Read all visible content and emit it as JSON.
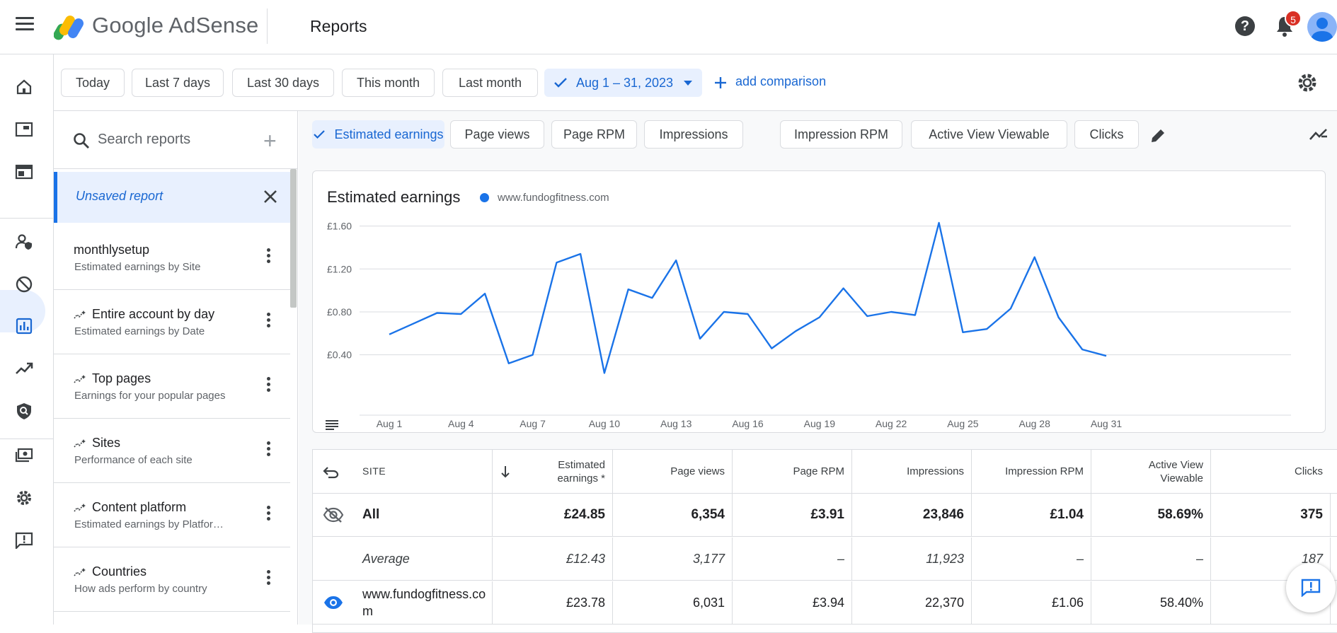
{
  "header": {
    "brand": "Google AdSense",
    "page_title": "Reports",
    "notifications_count": "5"
  },
  "date_filters": {
    "chips": [
      "Today",
      "Last 7 days",
      "Last 30 days",
      "This month",
      "Last month"
    ],
    "selected_range": "Aug 1 – 31, 2023",
    "add_comparison": "add comparison"
  },
  "reports": {
    "search_placeholder": "Search reports",
    "unsaved_label": "Unsaved report",
    "items": [
      {
        "title": "monthlysetup",
        "subtitle": "Estimated earnings by Site",
        "sparkle": false
      },
      {
        "title": "Entire account by day",
        "subtitle": "Estimated earnings by Date",
        "sparkle": true
      },
      {
        "title": "Top pages",
        "subtitle": "Earnings for your popular pages",
        "sparkle": true
      },
      {
        "title": "Sites",
        "subtitle": "Performance of each site",
        "sparkle": true
      },
      {
        "title": "Content platform",
        "subtitle": "Estimated earnings by Platfor…",
        "sparkle": true
      },
      {
        "title": "Countries",
        "subtitle": "How ads perform by country",
        "sparkle": true
      }
    ]
  },
  "metrics": {
    "chips": [
      "Estimated earnings",
      "Page views",
      "Page RPM",
      "Impressions",
      "Impression RPM",
      "Active View Viewable",
      "Clicks"
    ],
    "selected": "Estimated earnings"
  },
  "chart": {
    "title": "Estimated earnings",
    "legend": "www.fundogfitness.com",
    "accent": "#1a73e8"
  },
  "chart_data": {
    "type": "line",
    "title": "Estimated earnings",
    "series": [
      {
        "name": "www.fundogfitness.com",
        "values": [
          0.59,
          0.69,
          0.79,
          0.78,
          0.97,
          0.32,
          0.4,
          1.26,
          1.34,
          0.23,
          1.01,
          0.93,
          1.28,
          0.55,
          0.8,
          0.78,
          0.46,
          0.62,
          0.75,
          1.02,
          0.76,
          0.8,
          0.77,
          1.63,
          0.61,
          0.64,
          0.83,
          1.31,
          0.75,
          0.45,
          0.39
        ]
      }
    ],
    "x": [
      "Aug 1",
      "Aug 2",
      "Aug 3",
      "Aug 4",
      "Aug 5",
      "Aug 6",
      "Aug 7",
      "Aug 8",
      "Aug 9",
      "Aug 10",
      "Aug 11",
      "Aug 12",
      "Aug 13",
      "Aug 14",
      "Aug 15",
      "Aug 16",
      "Aug 17",
      "Aug 18",
      "Aug 19",
      "Aug 20",
      "Aug 21",
      "Aug 22",
      "Aug 23",
      "Aug 24",
      "Aug 25",
      "Aug 26",
      "Aug 27",
      "Aug 28",
      "Aug 29",
      "Aug 30",
      "Aug 31"
    ],
    "x_tick_labels": [
      "Aug 1",
      "Aug 4",
      "Aug 7",
      "Aug 10",
      "Aug 13",
      "Aug 16",
      "Aug 19",
      "Aug 22",
      "Aug 25",
      "Aug 28",
      "Aug 31"
    ],
    "y_tick_labels": [
      "£0.40",
      "£0.80",
      "£1.20",
      "£1.60"
    ],
    "y_ticks": [
      0.4,
      0.8,
      1.2,
      1.6
    ],
    "ylim": [
      0.2,
      1.65
    ],
    "grid": true
  },
  "table": {
    "headers": [
      "SITE",
      "Estimated earnings *",
      "Page views",
      "Page RPM",
      "Impressions",
      "Impression RPM",
      "Active View Viewable",
      "Clicks"
    ],
    "rows": [
      {
        "label": "All",
        "values": [
          "£24.85",
          "6,354",
          "£3.91",
          "23,846",
          "£1.04",
          "58.69%",
          "375"
        ]
      },
      {
        "label": "Average",
        "values": [
          "£12.43",
          "3,177",
          "–",
          "11,923",
          "–",
          "–",
          "187"
        ]
      },
      {
        "label": "www.fundogfitness.com",
        "values": [
          "£23.78",
          "6,031",
          "£3.94",
          "22,370",
          "£1.06",
          "58.40%",
          ""
        ]
      }
    ]
  }
}
